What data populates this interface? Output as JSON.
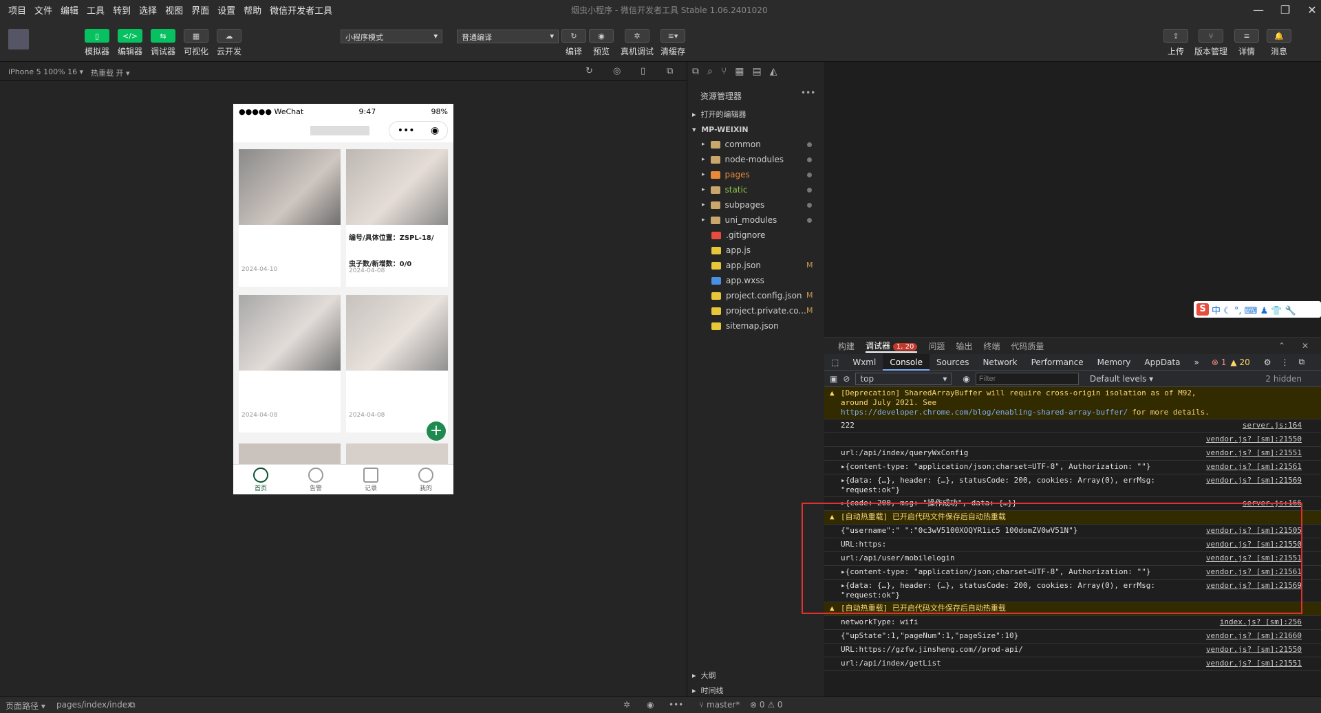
{
  "menu": [
    "项目",
    "文件",
    "编辑",
    "工具",
    "转到",
    "选择",
    "视图",
    "界面",
    "设置",
    "帮助",
    "微信开发者工具"
  ],
  "window_title": "烟虫小程序 - 微信开发者工具 Stable 1.06.2401020",
  "toolbar": {
    "left": [
      "模拟器",
      "编辑器",
      "调试器",
      "可视化",
      "云开发"
    ],
    "mode_select": "小程序模式",
    "compile_select": "普通编译",
    "mid": [
      "编译",
      "预览",
      "真机调试",
      "清缓存"
    ],
    "right": [
      "上传",
      "版本管理",
      "详情",
      "消息"
    ]
  },
  "subbar": {
    "device": "iPhone 5 100% 16 ▾",
    "hotreload": "热重载 开 ▾"
  },
  "phone": {
    "carrier": "●●●●● WeChat",
    "time": "9:47",
    "battery": "98%",
    "cards": [
      {
        "line1": "",
        "line2": "",
        "date": "2024-04-10"
      },
      {
        "line1": "编号/具体位置：ZSPL-18/",
        "line2": "虫子数/新增数：0/0",
        "date": "2024-04-08"
      },
      {
        "line1": "",
        "line2": "",
        "date": "2024-04-08"
      },
      {
        "line1": "",
        "line2": "",
        "date": "2024-04-08"
      }
    ],
    "tabs": [
      "首页",
      "告警",
      "记录",
      "我的"
    ]
  },
  "explorer": {
    "title": "资源管理器",
    "open_editors": "打开的编辑器",
    "root": "MP-WEIXIN",
    "items": [
      {
        "name": "common",
        "type": "folder",
        "badge": ""
      },
      {
        "name": "node-modules",
        "type": "folder",
        "badge": ""
      },
      {
        "name": "pages",
        "type": "folder-orange",
        "badge": ""
      },
      {
        "name": "static",
        "type": "folder",
        "badge": ""
      },
      {
        "name": "subpages",
        "type": "folder",
        "badge": ""
      },
      {
        "name": "uni_modules",
        "type": "folder",
        "badge": ""
      },
      {
        "name": ".gitignore",
        "type": "git",
        "badge": ""
      },
      {
        "name": "app.js",
        "type": "js",
        "badge": ""
      },
      {
        "name": "app.json",
        "type": "json",
        "badge": "M"
      },
      {
        "name": "app.wxss",
        "type": "css",
        "badge": ""
      },
      {
        "name": "project.config.json",
        "type": "json",
        "badge": "M"
      },
      {
        "name": "project.private.co...",
        "type": "json",
        "badge": "M"
      },
      {
        "name": "sitemap.json",
        "type": "json",
        "badge": ""
      }
    ],
    "outline": "大纲",
    "timeline": "时间线"
  },
  "devtools": {
    "top_tabs": [
      "构建",
      "调试器",
      "问题",
      "输出",
      "终端",
      "代码质量"
    ],
    "debugger_badge": "1, 20",
    "tabs": [
      "Wxml",
      "Console",
      "Sources",
      "Network",
      "Performance",
      "Memory",
      "AppData"
    ],
    "errors": "1",
    "warnings": "20",
    "context": "top",
    "filter_placeholder": "Filter",
    "levels": "Default levels ▾",
    "hidden": "2 hidden",
    "logs": [
      {
        "kind": "warn",
        "text": "[Deprecation] SharedArrayBuffer will require cross-origin isolation as of M92, around July 2021. See",
        "link": "https://developer.chrome.com/blog/enabling-shared-array-buffer/",
        "tail": "for more details.",
        "src": ""
      },
      {
        "kind": "log",
        "text": "222",
        "src": "server.js:164"
      },
      {
        "kind": "log",
        "text": "",
        "src": "vendor.js? [sm]:21550"
      },
      {
        "kind": "log",
        "text": "url:/api/index/queryWxConfig",
        "src": "vendor.js? [sm]:21551"
      },
      {
        "kind": "obj",
        "text": "▸{content-type: \"application/json;charset=UTF-8\", Authorization: \"\"}",
        "src": "vendor.js? [sm]:21561"
      },
      {
        "kind": "obj",
        "text": "▸{data: {…}, header: {…}, statusCode: 200, cookies: Array(0), errMsg: \"request:ok\"}",
        "src": "vendor.js? [sm]:21569"
      },
      {
        "kind": "obj",
        "text": "▸{code: 200, msg: \"操作成功\", data: {…}}",
        "src": "server.js:166"
      },
      {
        "kind": "warn",
        "text": "[自动热重载] 已开启代码文件保存后自动热重载",
        "src": ""
      },
      {
        "kind": "log",
        "text": "{\"username\":\"                              \":\"0c3wV5100XOQYR1ic5 100domZV0wV51N\"}",
        "src": "vendor.js? [sm]:21505"
      },
      {
        "kind": "log",
        "text": "URL:https:",
        "src": "vendor.js? [sm]:21550"
      },
      {
        "kind": "log",
        "text": "url:/api/user/mobilelogin",
        "src": "vendor.js? [sm]:21551"
      },
      {
        "kind": "obj",
        "text": "▸{content-type: \"application/json;charset=UTF-8\", Authorization: \"\"}",
        "src": "vendor.js? [sm]:21561"
      },
      {
        "kind": "obj",
        "text": "▸{data: {…}, header: {…}, statusCode: 200, cookies: Array(0), errMsg: \"request:ok\"}",
        "src": "vendor.js? [sm]:21569"
      },
      {
        "kind": "warn",
        "text": "[自动热重载] 已开启代码文件保存后自动热重载",
        "src": ""
      },
      {
        "kind": "log",
        "text": "networkType: wifi",
        "src": "index.js? [sm]:256"
      },
      {
        "kind": "log",
        "text": "{\"upState\":1,\"pageNum\":1,\"pageSize\":10}",
        "src": "vendor.js? [sm]:21660"
      },
      {
        "kind": "log",
        "text": "URL:https://gzfw.jinsheng.com//prod-api/",
        "src": "vendor.js? [sm]:21550"
      },
      {
        "kind": "log",
        "text": "url:/api/index/getList",
        "src": "vendor.js? [sm]:21551"
      }
    ]
  },
  "bottombar": {
    "path_label": "页面路径 ▾",
    "path": "pages/index/index",
    "branch": "master*",
    "status": "⊗ 0 ⚠ 0"
  },
  "ime": {
    "s": "S",
    "text": "中 ☾ °, ⌨ ♟ 👕 🔧"
  }
}
